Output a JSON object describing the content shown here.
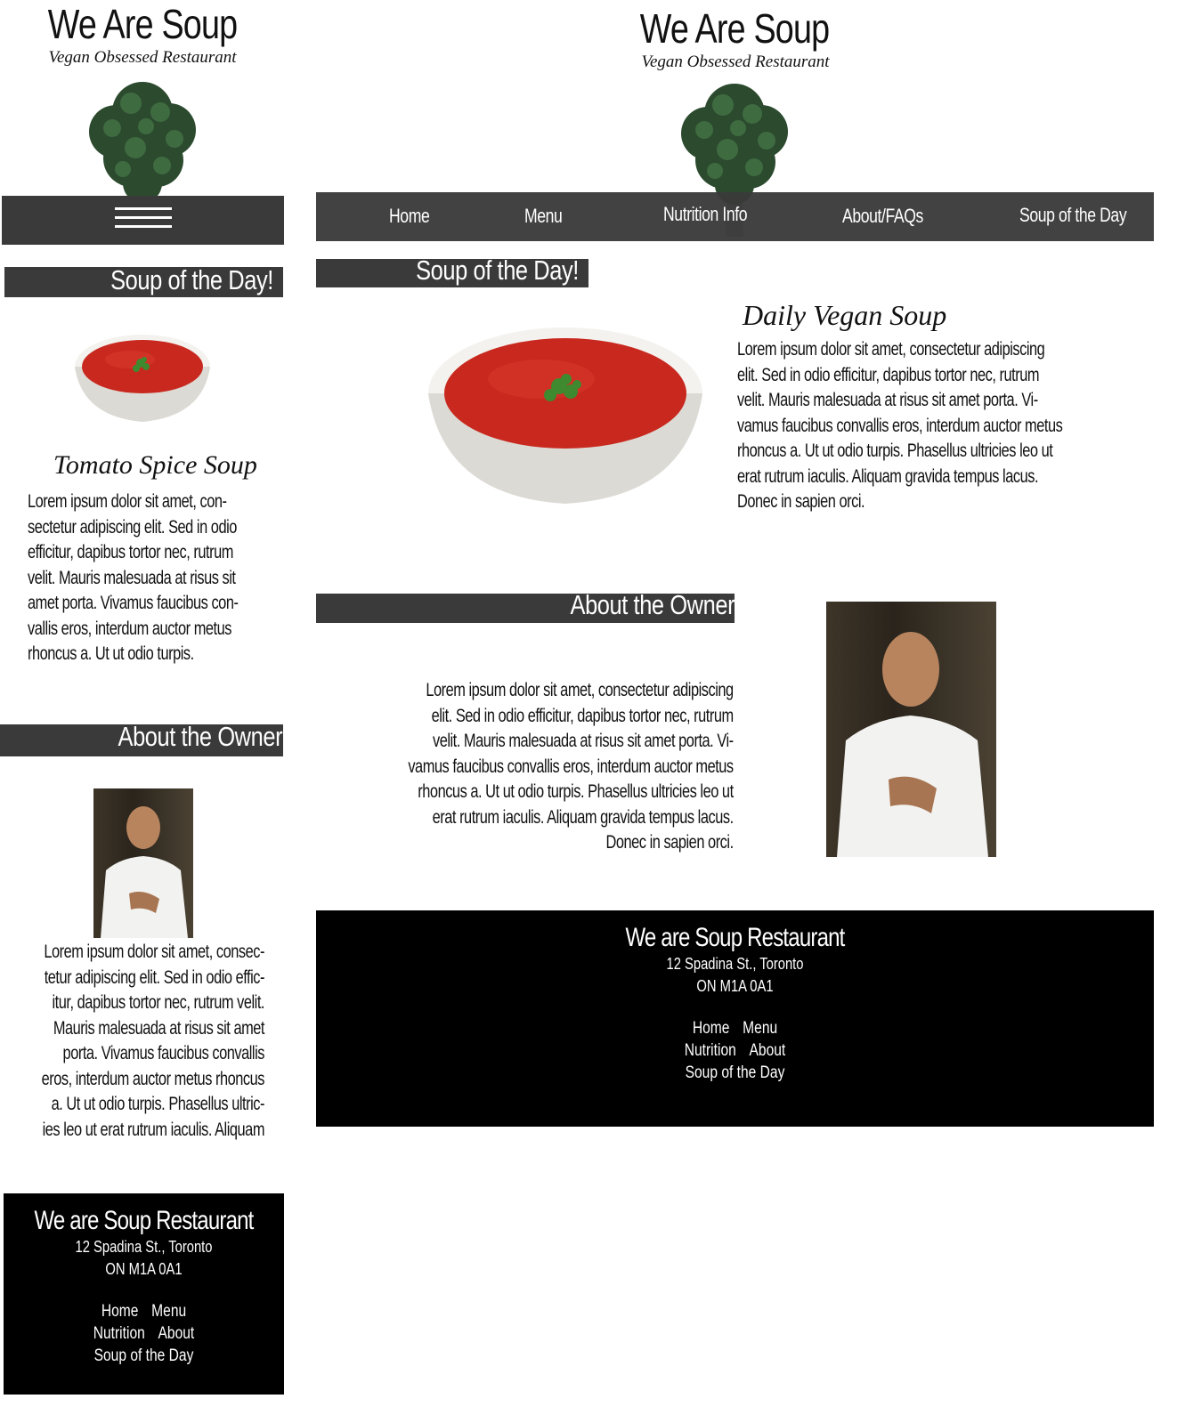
{
  "brand": {
    "title": "We Are Soup",
    "subtitle": "Vegan Obsessed Restaurant"
  },
  "nav": {
    "items": [
      "Home",
      "Menu",
      "Nutrition Info",
      "About/FAQs",
      "Soup of the Day"
    ]
  },
  "soup_section": {
    "heading": "Soup of the Day!",
    "mobile_soup_name": "Tomato Spice Soup",
    "desktop_soup_name": "Daily Vegan Soup",
    "mobile_lines": [
      "Lorem ipsum dolor sit amet, con-",
      "sectetur adipiscing elit. Sed in odio",
      "efficitur, dapibus tortor nec, rutrum",
      "velit. Mauris malesuada at risus sit",
      "amet porta. Vivamus faucibus con-",
      "vallis eros, interdum auctor metus",
      "rhoncus a. Ut ut odio turpis."
    ],
    "desktop_lines": [
      "Lorem ipsum dolor sit amet, consectetur adipiscing",
      "elit. Sed in odio efficitur, dapibus tortor nec, rutrum",
      "velit. Mauris malesuada at risus sit amet porta. Vi-",
      "vamus faucibus convallis eros, interdum auctor metus",
      "rhoncus a. Ut ut odio turpis. Phasellus ultricies leo ut",
      "erat rutrum iaculis. Aliquam gravida tempus lacus.",
      "Donec in sapien orci."
    ]
  },
  "owner_section": {
    "heading": "About the Owner",
    "mobile_lines": [
      "Lorem ipsum dolor sit amet, consec-",
      "tetur adipiscing elit. Sed in odio effic-",
      "itur, dapibus tortor nec, rutrum velit.",
      "Mauris malesuada at risus sit amet",
      "porta. Vivamus faucibus convallis",
      "eros, interdum auctor metus rhoncus",
      "a. Ut ut odio turpis. Phasellus ultric-",
      "ies leo ut erat rutrum iaculis. Aliquam"
    ],
    "desktop_lines": [
      "Lorem ipsum dolor sit amet, consectetur adipiscing",
      "elit. Sed in odio efficitur, dapibus tortor nec, rutrum",
      "velit. Mauris malesuada at risus sit amet porta. Vi-",
      "vamus faucibus convallis eros, interdum auctor metus",
      "rhoncus a. Ut ut odio turpis. Phasellus ultricies leo ut",
      "erat rutrum iaculis. Aliquam gravida tempus lacus.",
      "Donec in sapien orci."
    ]
  },
  "footer": {
    "title": "We are Soup Restaurant",
    "address_line1": "12 Spadina St., Toronto",
    "address_line2": "ON M1A 0A1",
    "links_row1": [
      "Home",
      "Menu"
    ],
    "links_row2": [
      "Nutrition",
      "About"
    ],
    "links_row3": [
      "Soup of the Day"
    ]
  },
  "colors": {
    "bar": "#3a3a3a",
    "footer_bg": "#000000",
    "soup_red": "#c8281e"
  }
}
